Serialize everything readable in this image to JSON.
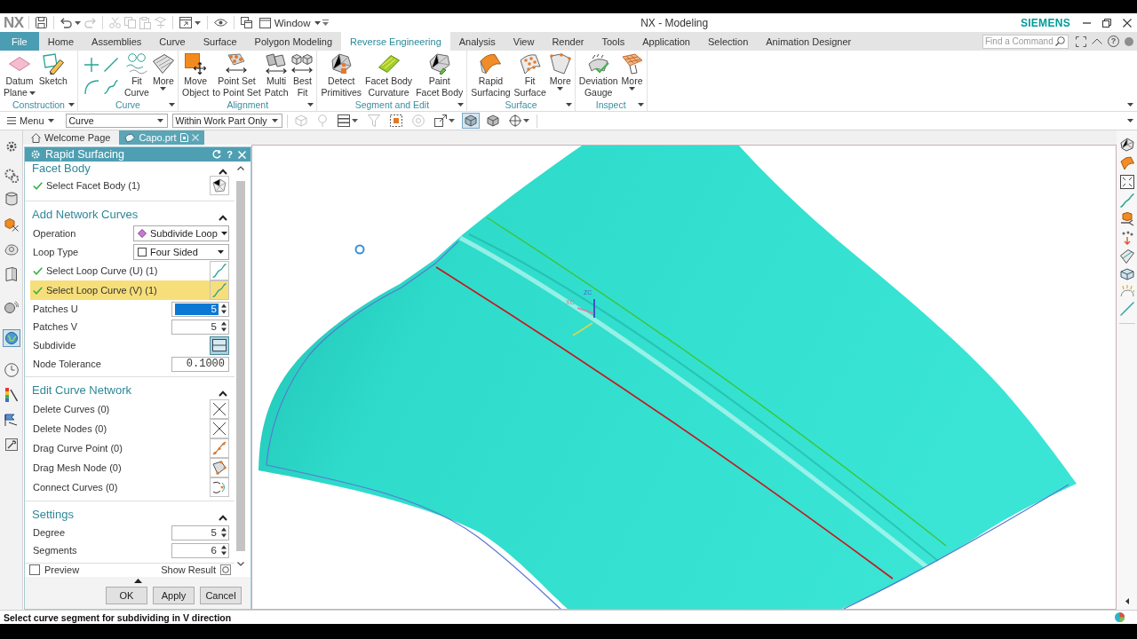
{
  "title_bar": {
    "logo": "NX",
    "quick_access": [
      {
        "disabled": false,
        "dropdown": false
      },
      {
        "disabled": false,
        "dropdown": true
      },
      {
        "disabled": true,
        "dropdown": false
      },
      {
        "disabled": true,
        "dropdown": false
      },
      {
        "disabled": true,
        "dropdown": false
      },
      {
        "disabled": true,
        "dropdown": false
      },
      {
        "disabled": true,
        "dropdown": false
      },
      {
        "disabled": false,
        "dropdown": true
      },
      {
        "disabled": false,
        "dropdown": false
      },
      {
        "disabled": false,
        "dropdown": false
      }
    ],
    "window_menu": "Window",
    "title": "NX - Modeling",
    "brand": "SIEMENS"
  },
  "tab_bar": {
    "tabs": [
      {
        "label": "File",
        "kind": "file",
        "selected": false
      },
      {
        "label": "Home",
        "kind": "tab",
        "selected": false
      },
      {
        "label": "Assemblies",
        "kind": "tab",
        "selected": false
      },
      {
        "label": "Curve",
        "kind": "tab",
        "selected": false
      },
      {
        "label": "Surface",
        "kind": "tab",
        "selected": false
      },
      {
        "label": "Polygon Modeling",
        "kind": "tab",
        "selected": false
      },
      {
        "label": "Reverse Engineering",
        "kind": "tab",
        "selected": true
      },
      {
        "label": "Analysis",
        "kind": "tab",
        "selected": false
      },
      {
        "label": "View",
        "kind": "tab",
        "selected": false
      },
      {
        "label": "Render",
        "kind": "tab",
        "selected": false
      },
      {
        "label": "Tools",
        "kind": "tab",
        "selected": false
      },
      {
        "label": "Application",
        "kind": "tab",
        "selected": false
      },
      {
        "label": "Selection",
        "kind": "tab",
        "selected": false
      },
      {
        "label": "Animation Designer",
        "kind": "tab",
        "selected": false
      }
    ],
    "search": {
      "placeholder": "Find a Command"
    },
    "help": "?"
  },
  "ribbon_groups": [
    {
      "label": "Construction",
      "menu": true,
      "commands": [
        {
          "kind": "large",
          "label": "Datum\nPlane",
          "dropdown": true
        },
        {
          "kind": "large",
          "label": "Sketch",
          "dropdown": false
        }
      ]
    },
    {
      "label": "Curve",
      "menu": true,
      "commands": [
        {
          "kind": "small"
        },
        {
          "kind": "small"
        },
        {
          "kind": "small"
        },
        {
          "kind": "small"
        },
        {
          "kind": "large",
          "label": "Fit\nCurve",
          "dropdown": false
        },
        {
          "kind": "split",
          "label": "More",
          "dropdown": true
        }
      ]
    },
    {
      "label": "Alignment",
      "menu": true,
      "commands": [
        {
          "kind": "large",
          "label": "Move\nObject",
          "dropdown": false
        },
        {
          "kind": "large",
          "label": "Point Set\nto Point Set",
          "dropdown": false
        },
        {
          "kind": "large",
          "label": "Multi\nPatch",
          "dropdown": false
        },
        {
          "kind": "large",
          "label": "Best\nFit",
          "dropdown": false
        }
      ]
    },
    {
      "label": "Segment and Edit",
      "menu": true,
      "commands": [
        {
          "kind": "large",
          "label": "Detect\nPrimitives",
          "dropdown": false
        },
        {
          "kind": "large",
          "label": "Facet Body\nCurvature",
          "dropdown": false
        },
        {
          "kind": "large",
          "label": "Paint\nFacet Body",
          "dropdown": false
        }
      ]
    },
    {
      "label": "Surface",
      "menu": true,
      "commands": [
        {
          "kind": "large",
          "label": "Rapid\nSurfacing",
          "dropdown": false
        },
        {
          "kind": "large",
          "label": "Fit\nSurface",
          "dropdown": false
        },
        {
          "kind": "split",
          "label": "More",
          "dropdown": true
        }
      ]
    },
    {
      "label": "Inspect",
      "menu": true,
      "commands": [
        {
          "kind": "large",
          "label": "Deviation\nGauge",
          "dropdown": false
        },
        {
          "kind": "split",
          "label": "More",
          "dropdown": true
        }
      ]
    }
  ],
  "selection_bar": {
    "menu": "Menu",
    "type_filter": "Curve",
    "scope": "Within Work Part Only",
    "tools": [
      {
        "disabled": true,
        "selected": false,
        "dropdown": false
      },
      {
        "disabled": true,
        "selected": false,
        "dropdown": false
      },
      {
        "disabled": false,
        "selected": false,
        "dropdown": true
      },
      {
        "disabled": true,
        "selected": false,
        "dropdown": false
      },
      {
        "disabled": false,
        "selected": false,
        "dropdown": false
      },
      {
        "disabled": true,
        "selected": false,
        "dropdown": false
      },
      {
        "disabled": false,
        "selected": false,
        "dropdown": true
      },
      {
        "disabled": false,
        "selected": true,
        "dropdown": false
      },
      {
        "disabled": false,
        "selected": false,
        "dropdown": false
      },
      {
        "disabled": false,
        "selected": false,
        "dropdown": true
      }
    ]
  },
  "resource_bar": {
    "tabs": [
      {
        "selected": false
      },
      {
        "selected": false
      },
      {
        "selected": false
      },
      {
        "selected": false
      },
      {
        "selected": false
      },
      {
        "selected": false
      },
      {
        "selected": false
      },
      {
        "selected": true
      },
      {
        "selected": false
      },
      {
        "selected": false
      },
      {
        "selected": false
      },
      {
        "selected": false
      }
    ]
  },
  "document_tabs": [
    {
      "label": "Welcome Page",
      "selected": false
    },
    {
      "label": "Capo.prt",
      "selected": true
    }
  ],
  "dialog": {
    "title": "Rapid Surfacing",
    "help": "?",
    "sections": [
      {
        "title": "Facet Body",
        "expanded": true,
        "rows": [
          {
            "kind": "selection",
            "label": "Select Facet Body (1)",
            "done": true,
            "active": false
          }
        ]
      },
      {
        "title": "Add Network Curves",
        "expanded": true,
        "rows": [
          {
            "kind": "dropdown",
            "label": "Operation",
            "value": "Subdivide Loop"
          },
          {
            "kind": "dropdown",
            "label": "Loop Type",
            "value": "Four Sided"
          },
          {
            "kind": "selection",
            "label": "Select Loop Curve (U) (1)",
            "done": true,
            "active": false
          },
          {
            "kind": "selection",
            "label": "Select Loop Curve (V) (1)",
            "done": true,
            "active": true
          },
          {
            "kind": "spinner",
            "label": "Patches U",
            "value": "5",
            "selected": true
          },
          {
            "kind": "spinner",
            "label": "Patches V",
            "value": "5",
            "selected": false
          },
          {
            "kind": "toggle",
            "label": "Subdivide",
            "on": true
          },
          {
            "kind": "number",
            "label": "Node Tolerance",
            "value": "0.1000"
          }
        ]
      },
      {
        "title": "Edit Curve Network",
        "expanded": true,
        "rows": [
          {
            "kind": "tool",
            "label": "Delete Curves (0)"
          },
          {
            "kind": "tool",
            "label": "Delete Nodes (0)"
          },
          {
            "kind": "tool",
            "label": "Drag Curve Point (0)"
          },
          {
            "kind": "tool",
            "label": "Drag Mesh Node (0)"
          },
          {
            "kind": "tool",
            "label": "Connect Curves (0)"
          }
        ]
      },
      {
        "title": "Settings",
        "expanded": true,
        "rows": [
          {
            "kind": "spinner",
            "label": "Degree",
            "value": "5",
            "selected": false
          },
          {
            "kind": "spinner",
            "label": "Segments",
            "value": "6",
            "selected": false
          }
        ]
      }
    ],
    "preview": {
      "label": "Preview",
      "checked": false
    },
    "show_result": {
      "label": "Show Result"
    },
    "buttons": [
      {
        "label": "OK"
      },
      {
        "label": "Apply"
      },
      {
        "label": "Cancel"
      }
    ]
  },
  "viewport": {
    "triad": {
      "z_label": "ZC",
      "x_label": "XC"
    }
  },
  "status_bar": {
    "prompt": "Select curve segment for subdividing in V direction"
  }
}
